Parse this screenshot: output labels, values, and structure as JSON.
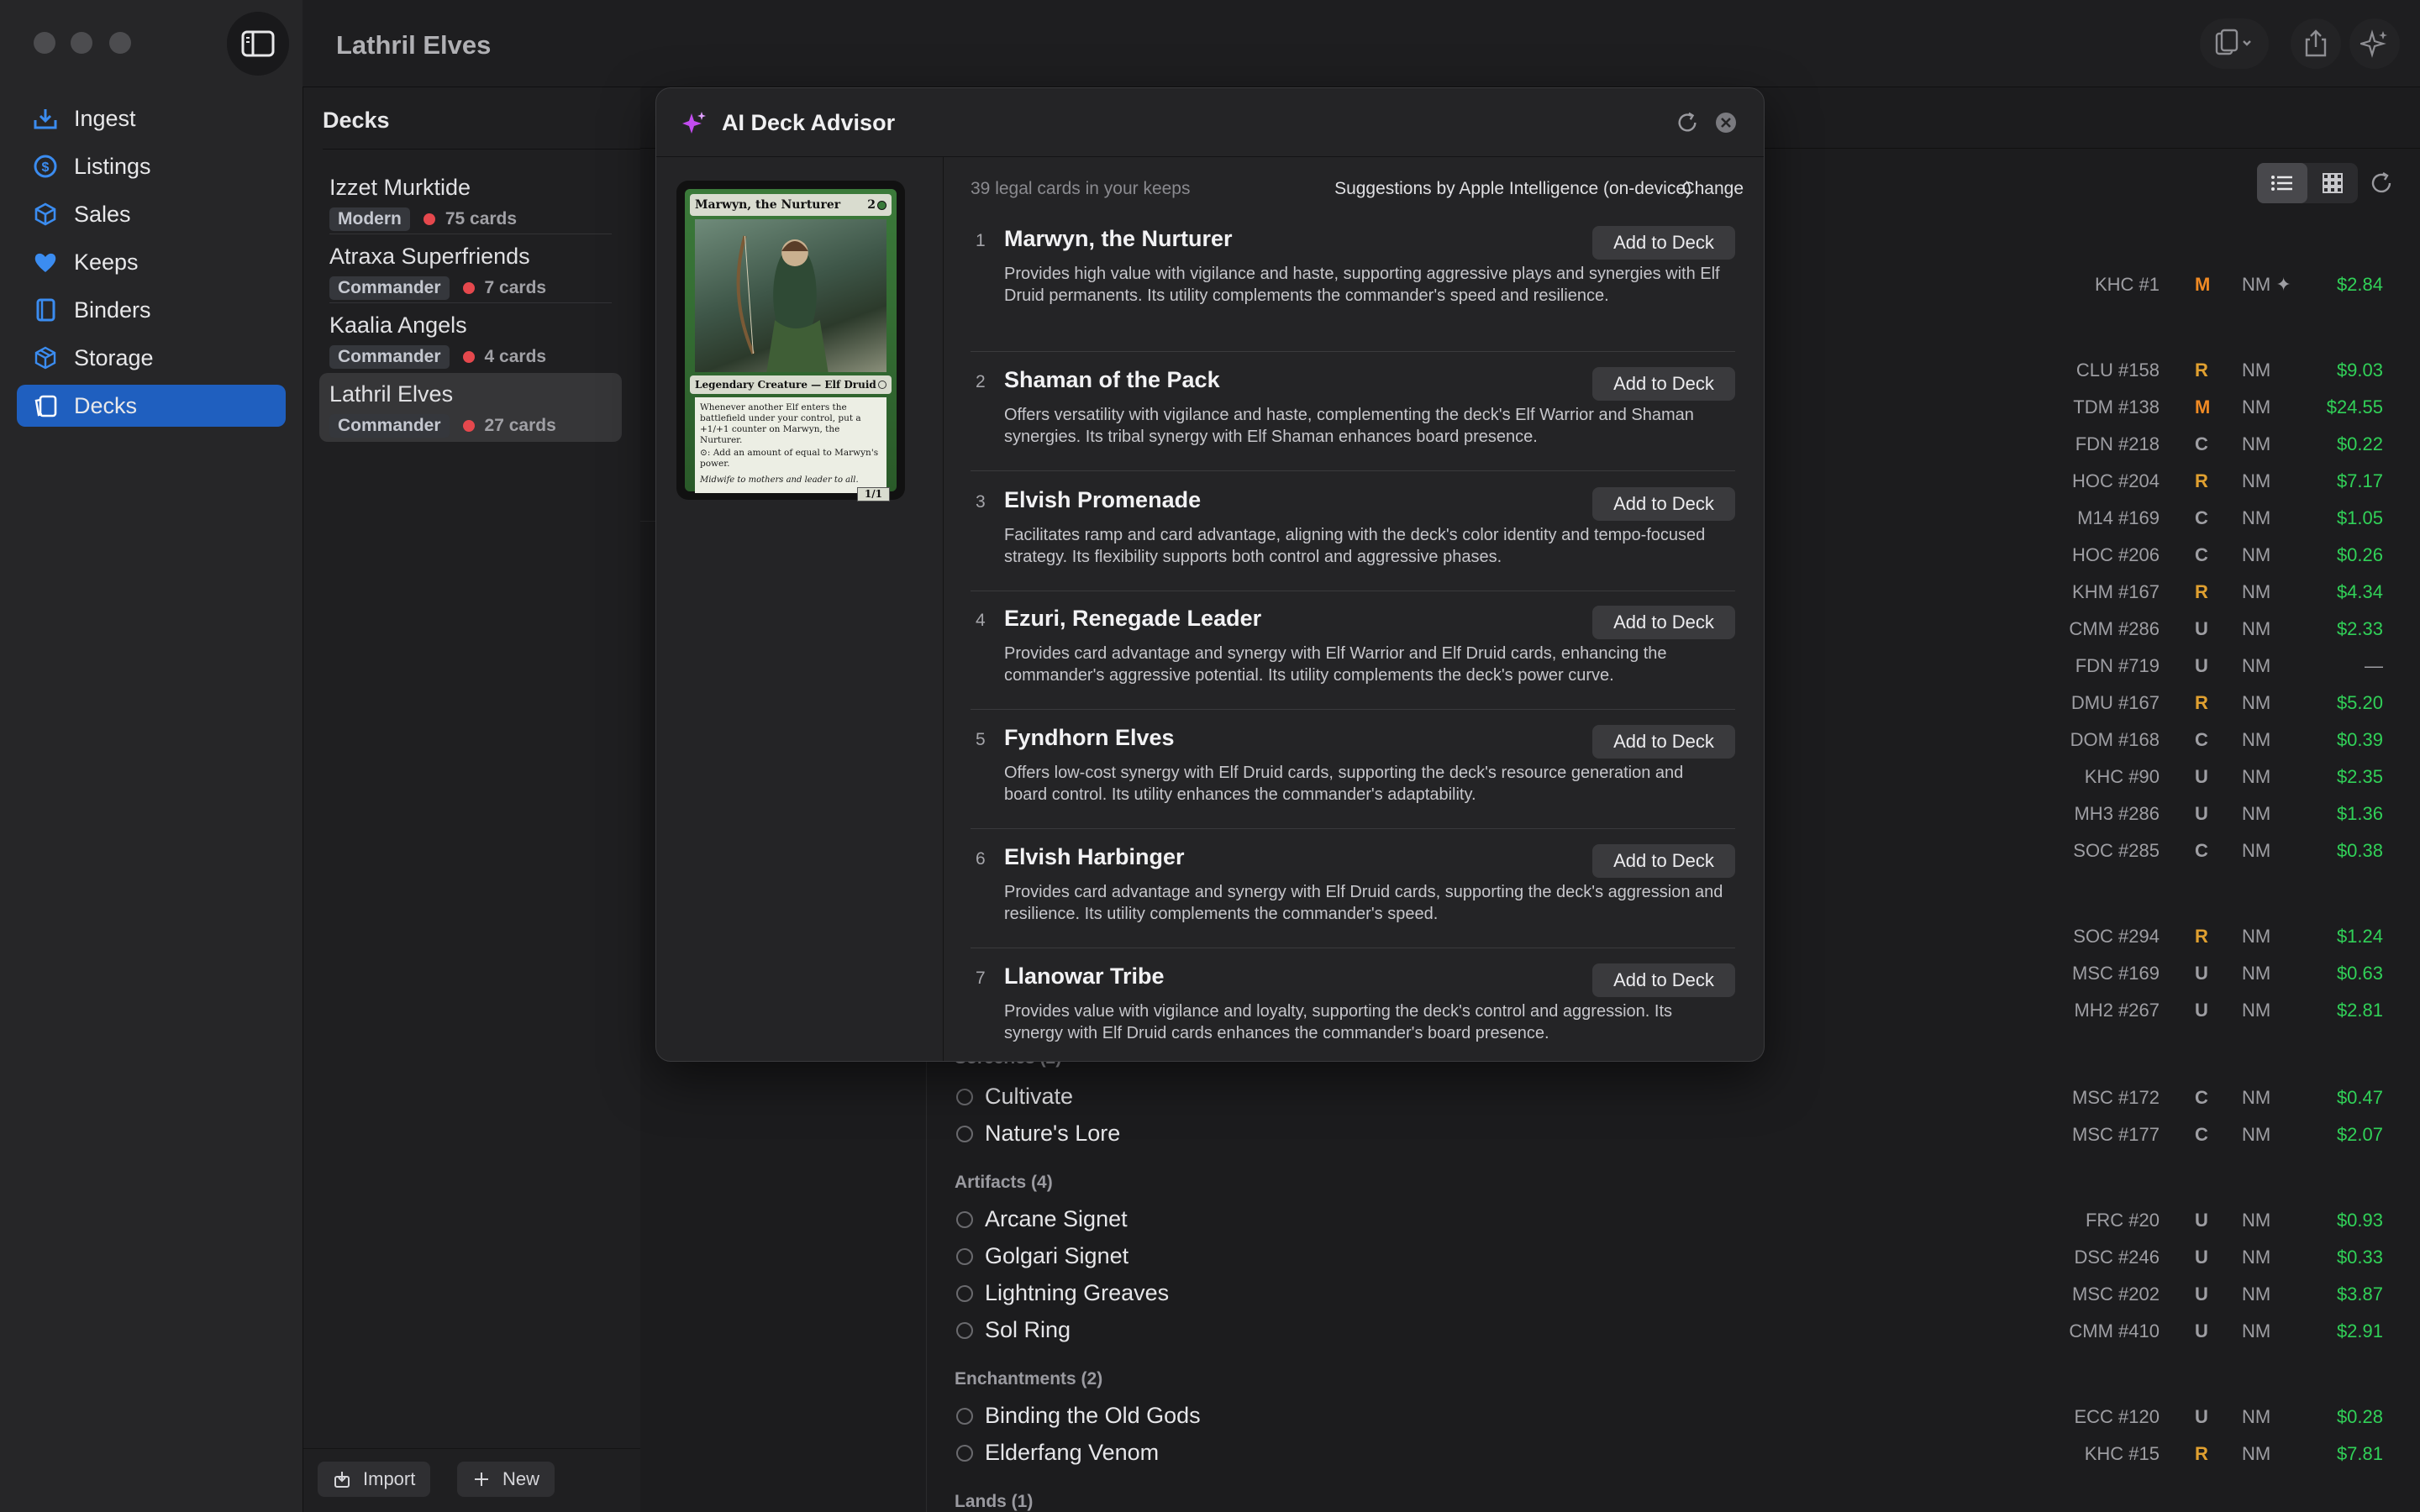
{
  "window": {
    "title": "Lathril Elves"
  },
  "sidebar": {
    "items": [
      {
        "label": "Ingest",
        "icon": "tray-arrow-down-icon"
      },
      {
        "label": "Listings",
        "icon": "dollar-circle-icon"
      },
      {
        "label": "Sales",
        "icon": "cube-icon"
      },
      {
        "label": "Keeps",
        "icon": "heart-icon"
      },
      {
        "label": "Binders",
        "icon": "book-icon"
      },
      {
        "label": "Storage",
        "icon": "shipping-box-icon"
      },
      {
        "label": "Decks",
        "icon": "cards-icon",
        "active": true
      }
    ]
  },
  "decks": {
    "header": "Decks",
    "items": [
      {
        "name": "Izzet Murktide",
        "format": "Modern",
        "count": "75 cards"
      },
      {
        "name": "Atraxa Superfriends",
        "format": "Commander",
        "count": "7 cards"
      },
      {
        "name": "Kaalia Angels",
        "format": "Commander",
        "count": "4 cards"
      },
      {
        "name": "Lathril Elves",
        "format": "Commander",
        "count": "27 cards",
        "active": true
      }
    ],
    "import_label": "Import",
    "new_label": "New"
  },
  "modal": {
    "title": "AI Deck Advisor",
    "legal_count": "39 legal cards in your keeps",
    "source": "Suggestions by Apple Intelligence (on-device)",
    "change_label": "Change",
    "add_label": "Add to Deck",
    "suggestions": [
      {
        "num": "1",
        "name": "Marwyn, the Nurturer",
        "desc": "Provides high value with vigilance and haste, supporting aggressive plays and synergies with Elf Druid permanents. Its utility complements the commander's speed and resilience."
      },
      {
        "num": "2",
        "name": "Shaman of the Pack",
        "desc": "Offers versatility with vigilance and haste, complementing the deck's Elf Warrior and Shaman synergies. Its tribal synergy with Elf Shaman enhances board presence."
      },
      {
        "num": "3",
        "name": "Elvish Promenade",
        "desc": "Facilitates ramp and card advantage, aligning with the deck's color identity and tempo-focused strategy. Its flexibility supports both control and aggressive phases."
      },
      {
        "num": "4",
        "name": "Ezuri, Renegade Leader",
        "desc": "Provides card advantage and synergy with Elf Warrior and Elf Druid cards, enhancing the commander's aggressive potential. Its utility complements the deck's power curve."
      },
      {
        "num": "5",
        "name": "Fyndhorn Elves",
        "desc": "Offers low-cost synergy with Elf Druid cards, supporting the deck's resource generation and board control. Its utility enhances the commander's adaptability."
      },
      {
        "num": "6",
        "name": "Elvish Harbinger",
        "desc": "Provides card advantage and synergy with Elf Druid cards, supporting the deck's aggression and resilience. Its utility complements the commander's speed."
      },
      {
        "num": "7",
        "name": "Llanowar Tribe",
        "desc": "Provides value with vigilance and loyalty, supporting the deck's control and aggression. Its synergy with Elf Druid cards enhances the commander's board presence."
      }
    ],
    "card": {
      "name": "Marwyn, the Nurturer",
      "cost": "2",
      "type": "Legendary Creature — Elf Druid",
      "text": "Whenever another Elf enters the battlefield under your control, put a +1/+1 counter on Marwyn, the Nurturer.",
      "text2": ": Add an amount of  equal to Marwyn's power.",
      "flavor": "Midwife to mothers and leader to all.",
      "pt": "1/1"
    }
  },
  "rows": [
    {
      "name": "",
      "code": "KHC #1",
      "rarity": "M",
      "cond": "NM ✦",
      "price": "$2.84"
    },
    {
      "name": "",
      "code": "CLU #158",
      "rarity": "R",
      "cond": "NM",
      "price": "$9.03"
    },
    {
      "name": "",
      "code": "TDM #138",
      "rarity": "M",
      "cond": "NM",
      "price": "$24.55"
    },
    {
      "name": "",
      "code": "FDN #218",
      "rarity": "C",
      "cond": "NM",
      "price": "$0.22"
    },
    {
      "name": "",
      "code": "HOC #204",
      "rarity": "R",
      "cond": "NM",
      "price": "$7.17"
    },
    {
      "name": "",
      "code": "M14 #169",
      "rarity": "C",
      "cond": "NM",
      "price": "$1.05"
    },
    {
      "name": "",
      "code": "HOC #206",
      "rarity": "C",
      "cond": "NM",
      "price": "$0.26"
    },
    {
      "name": "",
      "code": "KHM #167",
      "rarity": "R",
      "cond": "NM",
      "price": "$4.34"
    },
    {
      "name": "",
      "code": "CMM #286",
      "rarity": "U",
      "cond": "NM",
      "price": "$2.33"
    },
    {
      "name": "",
      "code": "FDN #719",
      "rarity": "U",
      "cond": "NM",
      "price": "—"
    },
    {
      "name": "",
      "code": "DMU #167",
      "rarity": "R",
      "cond": "NM",
      "price": "$5.20"
    },
    {
      "name": "",
      "code": "DOM #168",
      "rarity": "C",
      "cond": "NM",
      "price": "$0.39"
    },
    {
      "name": "",
      "code": "KHC #90",
      "rarity": "U",
      "cond": "NM",
      "price": "$2.35"
    },
    {
      "name": "",
      "code": "MH3 #286",
      "rarity": "U",
      "cond": "NM",
      "price": "$1.36"
    },
    {
      "name": "",
      "code": "SOC #285",
      "rarity": "C",
      "cond": "NM",
      "price": "$0.38"
    },
    {
      "name": "",
      "code": "SOC #294",
      "rarity": "R",
      "cond": "NM",
      "price": "$1.24"
    },
    {
      "name": "",
      "code": "MSC #169",
      "rarity": "U",
      "cond": "NM",
      "price": "$0.63"
    },
    {
      "name": "",
      "code": "MH2 #267",
      "rarity": "U",
      "cond": "NM",
      "price": "$2.81"
    },
    {
      "name": "Cultivate",
      "code": "MSC #172",
      "rarity": "C",
      "cond": "NM",
      "price": "$0.47"
    },
    {
      "name": "Nature's Lore",
      "code": "MSC #177",
      "rarity": "C",
      "cond": "NM",
      "price": "$2.07"
    },
    {
      "name": "Arcane Signet",
      "code": "FRC #20",
      "rarity": "U",
      "cond": "NM",
      "price": "$0.93"
    },
    {
      "name": "Golgari Signet",
      "code": "DSC #246",
      "rarity": "U",
      "cond": "NM",
      "price": "$0.33"
    },
    {
      "name": "Lightning Greaves",
      "code": "MSC #202",
      "rarity": "U",
      "cond": "NM",
      "price": "$3.87"
    },
    {
      "name": "Sol Ring",
      "code": "CMM #410",
      "rarity": "U",
      "cond": "NM",
      "price": "$2.91"
    },
    {
      "name": "Binding the Old Gods",
      "code": "ECC #120",
      "rarity": "U",
      "cond": "NM",
      "price": "$0.28"
    },
    {
      "name": "Elderfang Venom",
      "code": "KHC #15",
      "rarity": "R",
      "cond": "NM",
      "price": "$7.81"
    }
  ],
  "sections": {
    "sorceries": "Sorceries (2)",
    "artifacts": "Artifacts (4)",
    "enchantments": "Enchantments (2)",
    "lands": "Lands (1)"
  },
  "colors": {
    "accent": "#1f5fbf",
    "mythic": "#f08a24",
    "rare": "#e0a030",
    "price": "#31d158",
    "deck_dot": "#e5484d"
  }
}
